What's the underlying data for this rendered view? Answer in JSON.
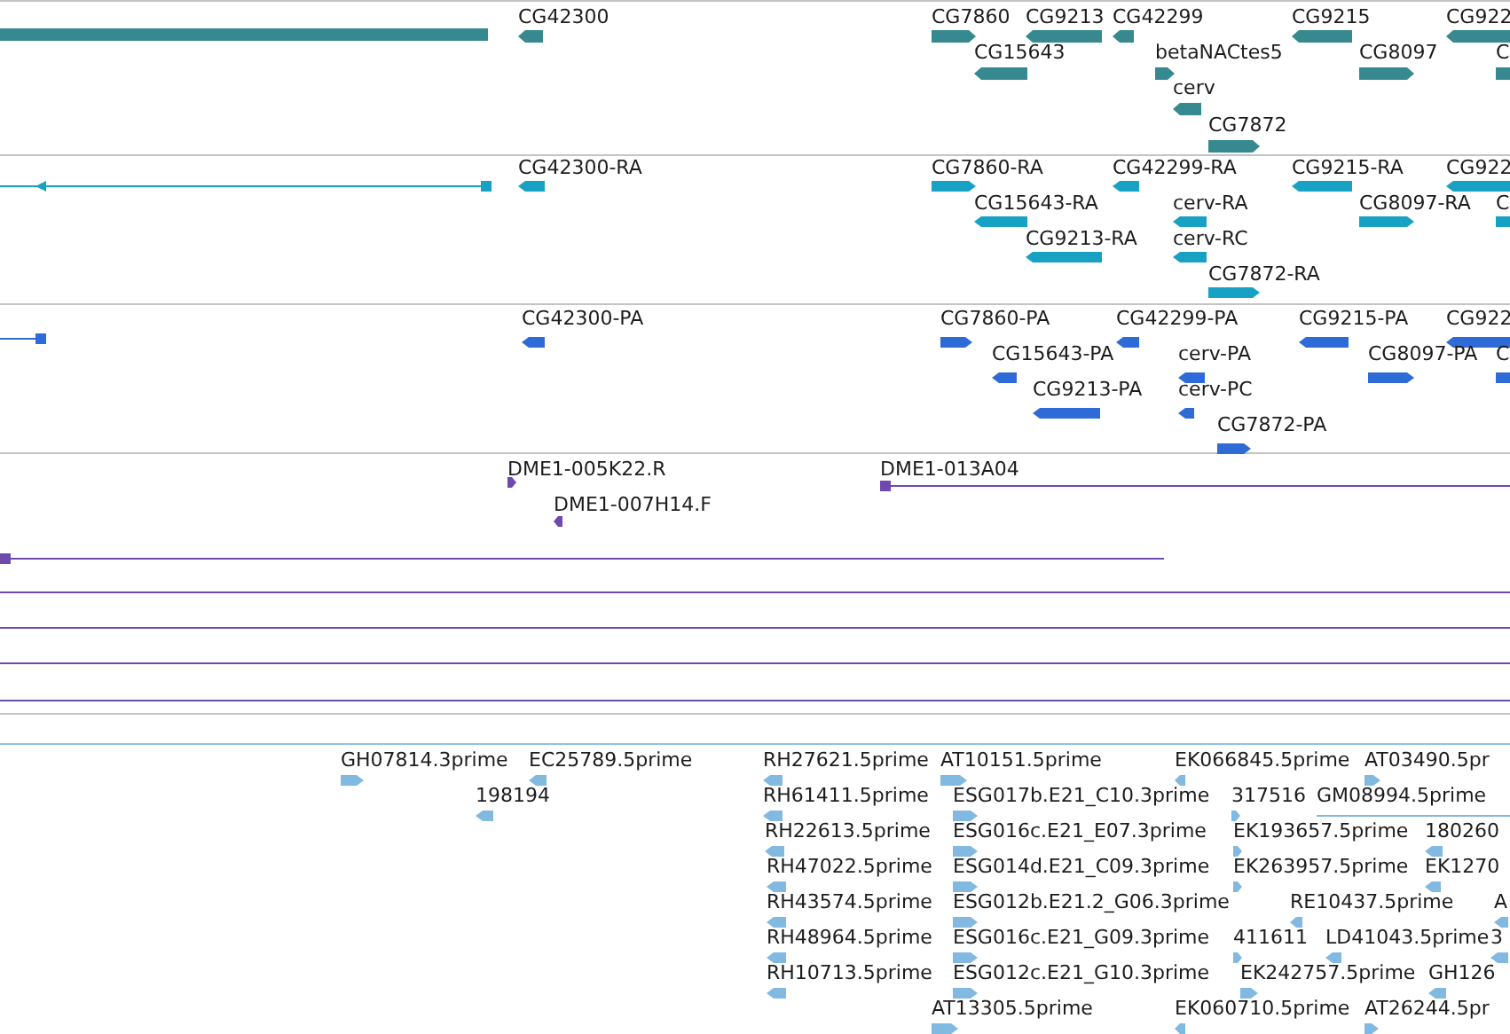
{
  "tracks": [
    {
      "color": "#35898f",
      "features": [
        {
          "kind": "block"
        },
        {
          "kind": "block",
          "label": "CG42300",
          "reverse": true
        },
        {
          "kind": "block",
          "label": "CG7860",
          "reverse": false
        },
        {
          "kind": "block",
          "label": "CG9213",
          "reverse": true
        },
        {
          "kind": "block",
          "label": "CG42299",
          "reverse": true
        },
        {
          "kind": "block",
          "label": "CG9215",
          "reverse": true
        },
        {
          "kind": "block",
          "label": "CG922",
          "reverse": true
        },
        {
          "kind": "block",
          "label": "CG15643",
          "reverse": true
        },
        {
          "kind": "block",
          "label": "betaNACtes5",
          "reverse": false
        },
        {
          "kind": "block",
          "label": "CG8097",
          "reverse": false
        },
        {
          "kind": "block",
          "label": "C"
        },
        {
          "kind": "block",
          "label": "cerv",
          "reverse": true
        },
        {
          "kind": "block",
          "label": "CG7872",
          "reverse": false
        }
      ]
    },
    {
      "color": "#17a2c4",
      "features": [
        {
          "kind": "line",
          "reverse": true
        },
        {
          "kind": "block",
          "label": "CG42300-RA",
          "reverse": true
        },
        {
          "kind": "block",
          "label": "CG7860-RA",
          "reverse": false
        },
        {
          "kind": "block",
          "label": "CG42299-RA",
          "reverse": true
        },
        {
          "kind": "block",
          "label": "CG9215-RA",
          "reverse": true
        },
        {
          "kind": "block",
          "label": "CG922",
          "reverse": true
        },
        {
          "kind": "block",
          "label": "CG15643-RA",
          "reverse": true
        },
        {
          "kind": "block",
          "label": "cerv-RA",
          "reverse": true
        },
        {
          "kind": "block",
          "label": "CG8097-RA",
          "reverse": false
        },
        {
          "kind": "block",
          "label": "C"
        },
        {
          "kind": "block",
          "label": "CG9213-RA",
          "reverse": true
        },
        {
          "kind": "block",
          "label": "cerv-RC",
          "reverse": true
        },
        {
          "kind": "block",
          "label": "CG7872-RA",
          "reverse": false
        }
      ]
    },
    {
      "color": "#2f6bd6",
      "features": [
        {
          "kind": "line",
          "reverse": true
        },
        {
          "kind": "block",
          "label": "CG42300-PA",
          "reverse": true
        },
        {
          "kind": "block",
          "label": "CG7860-PA",
          "reverse": false
        },
        {
          "kind": "block",
          "label": "CG42299-PA",
          "reverse": true
        },
        {
          "kind": "block",
          "label": "CG9215-PA",
          "reverse": true
        },
        {
          "kind": "block",
          "label": "CG922",
          "reverse": true
        },
        {
          "kind": "block",
          "label": "CG15643-PA",
          "reverse": true
        },
        {
          "kind": "block",
          "label": "cerv-PA",
          "reverse": true
        },
        {
          "kind": "block",
          "label": "CG8097-PA",
          "reverse": false
        },
        {
          "kind": "block",
          "label": "C"
        },
        {
          "kind": "block",
          "label": "CG9213-PA",
          "reverse": true
        },
        {
          "kind": "block",
          "label": "cerv-PC",
          "reverse": true
        },
        {
          "kind": "block",
          "label": "CG7872-PA",
          "reverse": false
        }
      ]
    },
    {
      "color": "#6f4aae",
      "features": [
        {
          "kind": "block",
          "label": "DME1-005K22.R",
          "reverse": false
        },
        {
          "kind": "line",
          "label": "DME1-013A04",
          "reverse": false
        },
        {
          "kind": "block",
          "label": "DME1-007H14.F",
          "reverse": true
        },
        {
          "kind": "line",
          "reverse": false
        },
        {
          "kind": "line"
        },
        {
          "kind": "line"
        },
        {
          "kind": "line"
        },
        {
          "kind": "line"
        }
      ]
    },
    {
      "color": "#82b9e0",
      "features": [
        {
          "kind": "block",
          "label": "GH07814.3prime",
          "reverse": false
        },
        {
          "kind": "block",
          "label": "EC25789.5prime",
          "reverse": true
        },
        {
          "kind": "block",
          "label": "198194",
          "reverse": true
        },
        {
          "kind": "block",
          "label": "RH27621.5prime",
          "reverse": true
        },
        {
          "kind": "block",
          "label": "AT10151.5prime",
          "reverse": false
        },
        {
          "kind": "block",
          "label": "EK066845.5prime",
          "reverse": true
        },
        {
          "kind": "block",
          "label": "AT03490.5pr",
          "reverse": false
        },
        {
          "kind": "block",
          "label": "RH61411.5prime",
          "reverse": true
        },
        {
          "kind": "block",
          "label": "ESG017b.E21_C10.3prime",
          "reverse": false
        },
        {
          "kind": "block",
          "label": "317516",
          "reverse": false
        },
        {
          "kind": "line",
          "label": "GM08994.5prime"
        },
        {
          "kind": "block",
          "label": "RH22613.5prime",
          "reverse": true
        },
        {
          "kind": "block",
          "label": "ESG016c.E21_E07.3prime",
          "reverse": false
        },
        {
          "kind": "block",
          "label": "EK193657.5prime",
          "reverse": false
        },
        {
          "kind": "block",
          "label": "180260",
          "reverse": true
        },
        {
          "kind": "block",
          "label": "RH47022.5prime",
          "reverse": true
        },
        {
          "kind": "block",
          "label": "ESG014d.E21_C09.3prime",
          "reverse": false
        },
        {
          "kind": "block",
          "label": "EK263957.5prime",
          "reverse": false
        },
        {
          "kind": "block",
          "label": "EK1270",
          "reverse": true
        },
        {
          "kind": "block",
          "label": "RH43574.5prime",
          "reverse": true
        },
        {
          "kind": "block",
          "label": "ESG012b.E21.2_G06.3prime",
          "reverse": false
        },
        {
          "kind": "block",
          "label": "RE10437.5prime",
          "reverse": true
        },
        {
          "kind": "block",
          "label": "A",
          "reverse": true
        },
        {
          "kind": "block",
          "label": "RH48964.5prime",
          "reverse": true
        },
        {
          "kind": "block",
          "label": "ESG016c.E21_G09.3prime",
          "reverse": false
        },
        {
          "kind": "block",
          "label": "411611",
          "reverse": false
        },
        {
          "kind": "block",
          "label": "LD41043.5prime",
          "reverse": true
        },
        {
          "kind": "block",
          "label": "3",
          "reverse": true
        },
        {
          "kind": "block",
          "label": "RH10713.5prime",
          "reverse": true
        },
        {
          "kind": "block",
          "label": "ESG012c.E21_G10.3prime",
          "reverse": false
        },
        {
          "kind": "block",
          "label": "EK242757.5prime",
          "reverse": false
        },
        {
          "kind": "block",
          "label": "GH126",
          "reverse": true
        },
        {
          "kind": "block",
          "label": "AT13305.5prime",
          "reverse": false
        },
        {
          "kind": "block",
          "label": "EK060710.5prime",
          "reverse": true
        },
        {
          "kind": "block",
          "label": "AT26244.5pr",
          "reverse": false
        }
      ]
    }
  ]
}
